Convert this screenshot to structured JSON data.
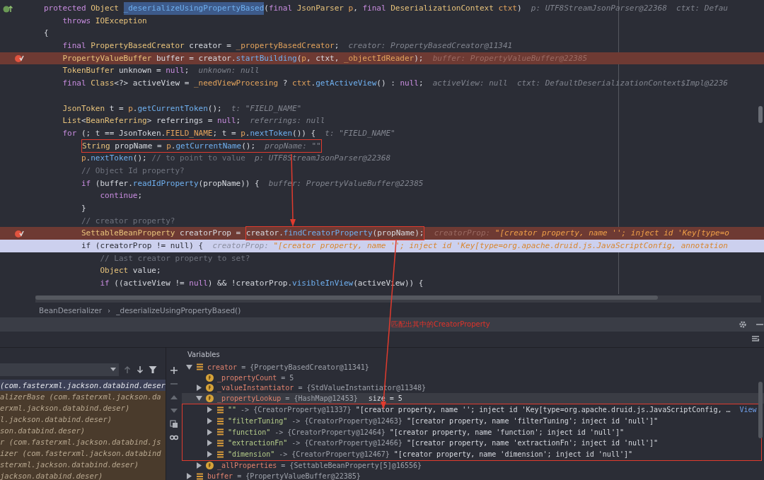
{
  "editor": {
    "lines": [
      {
        "kind": "signature",
        "breakpoint": false,
        "current": false,
        "segments": [
          {
            "kind": "k",
            "text": "protected "
          },
          {
            "kind": "t",
            "text": "Object "
          },
          {
            "kind": "sel",
            "text": "_deserializeUsingPropertyBased"
          },
          {
            "kind": "p",
            "text": "("
          },
          {
            "kind": "k",
            "text": "final "
          },
          {
            "kind": "t",
            "text": "JsonParser "
          },
          {
            "kind": "f",
            "text": "p"
          },
          {
            "kind": "p",
            "text": ", "
          },
          {
            "kind": "k",
            "text": "final "
          },
          {
            "kind": "t",
            "text": "DeserializationContext "
          },
          {
            "kind": "f",
            "text": "ctxt"
          },
          {
            "kind": "p",
            "text": ")"
          },
          {
            "kind": "h",
            "text": "p: UTF8StreamJsonParser@22368  ctxt: Defau"
          }
        ]
      },
      {
        "kind": "code",
        "breakpoint": false,
        "current": false,
        "segments": [
          {
            "kind": "k",
            "text": "    throws "
          },
          {
            "kind": "t",
            "text": "IOException"
          }
        ]
      },
      {
        "kind": "code",
        "breakpoint": false,
        "current": false,
        "segments": [
          {
            "kind": "p",
            "text": "{"
          }
        ]
      },
      {
        "kind": "code",
        "breakpoint": false,
        "current": false,
        "segments": [
          {
            "kind": "k",
            "text": "    final "
          },
          {
            "kind": "t",
            "text": "PropertyBasedCreator "
          },
          {
            "kind": "p",
            "text": "creator = "
          },
          {
            "kind": "f",
            "text": "_propertyBasedCreator"
          },
          {
            "kind": "p",
            "text": ";"
          },
          {
            "kind": "h",
            "text": "creator: PropertyBasedCreator@11341"
          }
        ]
      },
      {
        "kind": "code",
        "breakpoint": true,
        "current": false,
        "segments": [
          {
            "kind": "t",
            "text": "    PropertyValueBuffer "
          },
          {
            "kind": "p",
            "text": "buffer = creator."
          },
          {
            "kind": "m",
            "text": "startBuilding"
          },
          {
            "kind": "p",
            "text": "("
          },
          {
            "kind": "f",
            "text": "p"
          },
          {
            "kind": "p",
            "text": ", ctxt, "
          },
          {
            "kind": "f",
            "text": "_objectIdReader"
          },
          {
            "kind": "p",
            "text": ");"
          },
          {
            "kind": "h",
            "text": "buffer: PropertyValueBuffer@22385"
          }
        ]
      },
      {
        "kind": "code",
        "breakpoint": false,
        "current": false,
        "segments": [
          {
            "kind": "t",
            "text": "    TokenBuffer "
          },
          {
            "kind": "p",
            "text": "unknown = "
          },
          {
            "kind": "k",
            "text": "null"
          },
          {
            "kind": "p",
            "text": ";"
          },
          {
            "kind": "h",
            "text": "unknown: null"
          }
        ]
      },
      {
        "kind": "code",
        "breakpoint": false,
        "current": false,
        "segments": [
          {
            "kind": "k",
            "text": "    final "
          },
          {
            "kind": "t",
            "text": "Class"
          },
          {
            "kind": "p",
            "text": "<?> activeView = "
          },
          {
            "kind": "f",
            "text": "_needViewProcesing"
          },
          {
            "kind": "p",
            "text": " ? "
          },
          {
            "kind": "f",
            "text": "ctxt"
          },
          {
            "kind": "p",
            "text": "."
          },
          {
            "kind": "m",
            "text": "getActiveView"
          },
          {
            "kind": "p",
            "text": "() : "
          },
          {
            "kind": "k",
            "text": "null"
          },
          {
            "kind": "p",
            "text": ";"
          },
          {
            "kind": "h",
            "text": "activeView: null  ctxt: DefaultDeserializationContext$Impl@2236"
          }
        ]
      },
      {
        "kind": "code",
        "breakpoint": false,
        "current": false
      },
      {
        "kind": "code",
        "breakpoint": false,
        "current": false,
        "segments": [
          {
            "kind": "t",
            "text": "    JsonToken "
          },
          {
            "kind": "p",
            "text": "t = "
          },
          {
            "kind": "f",
            "text": "p"
          },
          {
            "kind": "p",
            "text": "."
          },
          {
            "kind": "m",
            "text": "getCurrentToken"
          },
          {
            "kind": "p",
            "text": "();"
          },
          {
            "kind": "h",
            "text": "t: \"FIELD_NAME\""
          }
        ]
      },
      {
        "kind": "code",
        "breakpoint": false,
        "current": false,
        "segments": [
          {
            "kind": "t",
            "text": "    List"
          },
          {
            "kind": "p",
            "text": "<"
          },
          {
            "kind": "t",
            "text": "BeanReferring"
          },
          {
            "kind": "p",
            "text": "> referrings = "
          },
          {
            "kind": "k",
            "text": "null"
          },
          {
            "kind": "p",
            "text": ";"
          },
          {
            "kind": "h",
            "text": "referrings: null"
          }
        ]
      },
      {
        "kind": "code",
        "breakpoint": false,
        "current": false,
        "segments": [
          {
            "kind": "k",
            "text": "    for "
          },
          {
            "kind": "p",
            "text": "(; t == JsonToken."
          },
          {
            "kind": "f",
            "text": "FIELD_NAME"
          },
          {
            "kind": "p",
            "text": "; t = "
          },
          {
            "kind": "f",
            "text": "p"
          },
          {
            "kind": "p",
            "text": "."
          },
          {
            "kind": "m",
            "text": "nextToken"
          },
          {
            "kind": "p",
            "text": "()) {"
          },
          {
            "kind": "h",
            "text": "t: \"FIELD_NAME\""
          }
        ]
      },
      {
        "kind": "code",
        "breakpoint": false,
        "current": false,
        "segments": [
          {
            "kind": "t",
            "text": "        String ",
            "boxed": true
          },
          {
            "kind": "p",
            "text": "propName = ",
            "boxed": true
          },
          {
            "kind": "f",
            "text": "p",
            "boxed": true
          },
          {
            "kind": "p",
            "text": ".",
            "boxed": true
          },
          {
            "kind": "m",
            "text": "getCurrentName",
            "boxed": true
          },
          {
            "kind": "p",
            "text": "();",
            "boxed": true
          },
          {
            "kind": "h",
            "text": "propName: \"\"",
            "boxed": true
          }
        ]
      },
      {
        "kind": "code",
        "breakpoint": false,
        "current": false,
        "segments": [
          {
            "kind": "f",
            "text": "        p"
          },
          {
            "kind": "p",
            "text": "."
          },
          {
            "kind": "m",
            "text": "nextToken"
          },
          {
            "kind": "p",
            "text": "(); "
          },
          {
            "kind": "c",
            "text": "// to point to value"
          },
          {
            "kind": "h",
            "text": "p: UTF8StreamJsonParser@22368"
          }
        ]
      },
      {
        "kind": "code",
        "breakpoint": false,
        "current": false,
        "segments": [
          {
            "kind": "c",
            "text": "        // Object Id property?"
          }
        ]
      },
      {
        "kind": "code",
        "breakpoint": false,
        "current": false,
        "segments": [
          {
            "kind": "k",
            "text": "        if "
          },
          {
            "kind": "p",
            "text": "(buffer."
          },
          {
            "kind": "m",
            "text": "readIdProperty"
          },
          {
            "kind": "p",
            "text": "(propName)) {"
          },
          {
            "kind": "h",
            "text": "buffer: PropertyValueBuffer@22385"
          }
        ]
      },
      {
        "kind": "code",
        "breakpoint": false,
        "current": false,
        "segments": [
          {
            "kind": "k",
            "text": "            continue"
          },
          {
            "kind": "p",
            "text": ";"
          }
        ]
      },
      {
        "kind": "code",
        "breakpoint": false,
        "current": false,
        "segments": [
          {
            "kind": "p",
            "text": "        }"
          }
        ]
      },
      {
        "kind": "code",
        "breakpoint": false,
        "current": false,
        "segments": [
          {
            "kind": "c",
            "text": "        // creator property?"
          }
        ]
      },
      {
        "kind": "code",
        "breakpoint": true,
        "current": false,
        "segments": [
          {
            "kind": "t",
            "text": "        SettableBeanProperty "
          },
          {
            "kind": "p",
            "text": "creatorProp = "
          },
          {
            "kind": "p",
            "text": "creator.",
            "boxed": true
          },
          {
            "kind": "m",
            "text": "findCreatorProperty",
            "boxed": true
          },
          {
            "kind": "p",
            "text": "(propName);",
            "boxed": true
          },
          {
            "kind": "h",
            "text": "creatorProp:"
          },
          {
            "kind": "hv",
            "text": " \"[creator property, name ''; inject id 'Key[type=o"
          }
        ]
      },
      {
        "kind": "code",
        "breakpoint": false,
        "current": true,
        "segments": [
          {
            "kind": "k",
            "text": "        if "
          },
          {
            "kind": "p",
            "text": "(creatorProp != "
          },
          {
            "kind": "k",
            "text": "null"
          },
          {
            "kind": "p",
            "text": ") {"
          },
          {
            "kind": "h",
            "text": "creatorProp:"
          },
          {
            "kind": "hv",
            "text": " \"[creator property, name ''; inject id 'Key[type=org.apache.druid.js.JavaScriptConfig, annotation"
          }
        ]
      },
      {
        "kind": "code",
        "breakpoint": false,
        "current": false,
        "segments": [
          {
            "kind": "c",
            "text": "            // Last creator property to set?"
          }
        ]
      },
      {
        "kind": "code",
        "breakpoint": false,
        "current": false,
        "segments": [
          {
            "kind": "t",
            "text": "            Object "
          },
          {
            "kind": "p",
            "text": "value;"
          }
        ]
      },
      {
        "kind": "code",
        "breakpoint": false,
        "current": false,
        "segments": [
          {
            "kind": "k",
            "text": "            if "
          },
          {
            "kind": "p",
            "text": "((activeView != "
          },
          {
            "kind": "k",
            "text": "null"
          },
          {
            "kind": "p",
            "text": ") && !creatorProp."
          },
          {
            "kind": "m",
            "text": "visibleInView"
          },
          {
            "kind": "p",
            "text": "(activeView)) {"
          }
        ]
      }
    ]
  },
  "breadcrumb": [
    "BeanDeserializer",
    "›",
    "_deserializeUsingPropertyBased()"
  ],
  "annotation": {
    "note": "匹配出其中的CreatorProperty"
  },
  "frames": {
    "items": [
      {
        "text": "(com.fasterxml.jackson.databind.deser",
        "selected": true
      },
      {
        "text": "alizerBase (com.fasterxml.jackson.da",
        "selected": false
      },
      {
        "text": "erxml.jackson.databind.deser)",
        "selected": false
      },
      {
        "text": "l.jackson.databind.deser)",
        "selected": false
      },
      {
        "text": "son.databind.deser)",
        "selected": false
      },
      {
        "text": "r (com.fasterxml.jackson.databind.js",
        "selected": false
      },
      {
        "text": "izer (com.fasterxml.jackson.databind",
        "selected": false
      },
      {
        "text": "sterxml.jackson.databind.deser)",
        "selected": false
      },
      {
        "text": "jackson.databind.deser)",
        "selected": false
      }
    ]
  },
  "variables": {
    "title": "Variables",
    "tree": [
      {
        "kind": "object",
        "name": "creator",
        "value": "= {PropertyBasedCreator@11341}",
        "expanded": true,
        "selected": false,
        "children": [
          {
            "kind": "field-leaf",
            "name": "_propertyCount",
            "value": "= 5",
            "selected": false
          },
          {
            "kind": "field",
            "name": "_valueInstantiator",
            "value": "= {StdValueInstantiator@11348}",
            "expanded": false,
            "selected": false
          },
          {
            "kind": "field",
            "name": "_propertyLookup",
            "value": "= {HashMap@12453}",
            "extra": "size = 5",
            "expanded": true,
            "selected": true,
            "boxed": true,
            "children": [
              {
                "kind": "object",
                "key": "\"\"",
                "value": "-> {CreatorProperty@11337}",
                "text": "\"[creator property, name ''; inject id 'Key[type=org.apache.druid.js.JavaScriptConfig, …",
                "link": "View",
                "expanded": false,
                "selected": false
              },
              {
                "kind": "object",
                "key": "\"filterTuning\"",
                "value": "-> {CreatorProperty@12463}",
                "text": "\"[creator property, name 'filterTuning'; inject id 'null']\"",
                "expanded": false,
                "selected": false
              },
              {
                "kind": "object",
                "key": "\"function\"",
                "value": "-> {CreatorProperty@12464}",
                "text": "\"[creator property, name 'function'; inject id 'null']\"",
                "expanded": false,
                "selected": false
              },
              {
                "kind": "object",
                "key": "\"extractionFn\"",
                "value": "-> {CreatorProperty@12466}",
                "text": "\"[creator property, name 'extractionFn'; inject id 'null']\"",
                "expanded": false,
                "selected": false
              },
              {
                "kind": "object",
                "key": "\"dimension\"",
                "value": "-> {CreatorProperty@12467}",
                "text": "\"[creator property, name 'dimension'; inject id 'null']\"",
                "expanded": false,
                "selected": false
              }
            ]
          },
          {
            "kind": "field",
            "name": "_allProperties",
            "value": "= {SettableBeanProperty[5]@16556}",
            "expanded": false,
            "selected": false
          }
        ]
      },
      {
        "kind": "object",
        "name": "buffer",
        "value": "= {PropertyValueBuffer@22385}",
        "expanded": false,
        "selected": false
      }
    ]
  }
}
